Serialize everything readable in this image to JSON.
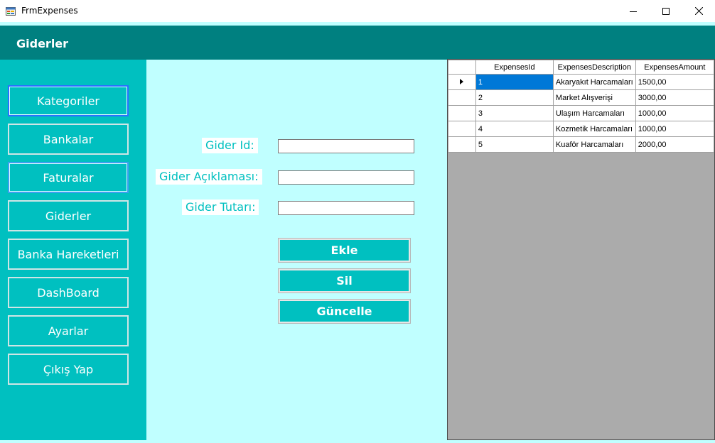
{
  "window": {
    "title": "FrmExpenses",
    "icon": "form-icon",
    "controls": {
      "minimize": "minimize-icon",
      "maximize": "maximize-icon",
      "close": "close-icon"
    }
  },
  "header": {
    "title": "Giderler"
  },
  "sidebar": {
    "items": [
      {
        "label": "Kategoriler"
      },
      {
        "label": "Bankalar"
      },
      {
        "label": "Faturalar"
      },
      {
        "label": "Giderler"
      },
      {
        "label": "Banka Hareketleri"
      },
      {
        "label": "DashBoard"
      },
      {
        "label": "Ayarlar"
      },
      {
        "label": "Çıkış Yap"
      }
    ]
  },
  "form": {
    "fields": [
      {
        "label": "Gider Id:",
        "value": ""
      },
      {
        "label": "Gider Açıklaması:",
        "value": ""
      },
      {
        "label": "Gider Tutarı:",
        "value": ""
      }
    ],
    "buttons": {
      "add": "Ekle",
      "delete": "Sil",
      "update": "Güncelle"
    }
  },
  "grid": {
    "columns": [
      "ExpensesId",
      "ExpensesDescription",
      "ExpensesAmount"
    ],
    "rows": [
      {
        "id": "1",
        "description": "Akaryakıt Harcamaları",
        "amount": "1500,00"
      },
      {
        "id": "2",
        "description": "Market Alışverişi",
        "amount": "3000,00"
      },
      {
        "id": "3",
        "description": "Ulaşım Harcamaları",
        "amount": "1000,00"
      },
      {
        "id": "4",
        "description": "Kozmetik Harcamaları",
        "amount": "1000,00"
      },
      {
        "id": "5",
        "description": "Kuaför Harcamaları",
        "amount": "2000,00"
      }
    ]
  },
  "colors": {
    "header": "#008080",
    "sidebar": "#00c0c0",
    "content": "#c0ffff",
    "selection": "#0078d7"
  }
}
